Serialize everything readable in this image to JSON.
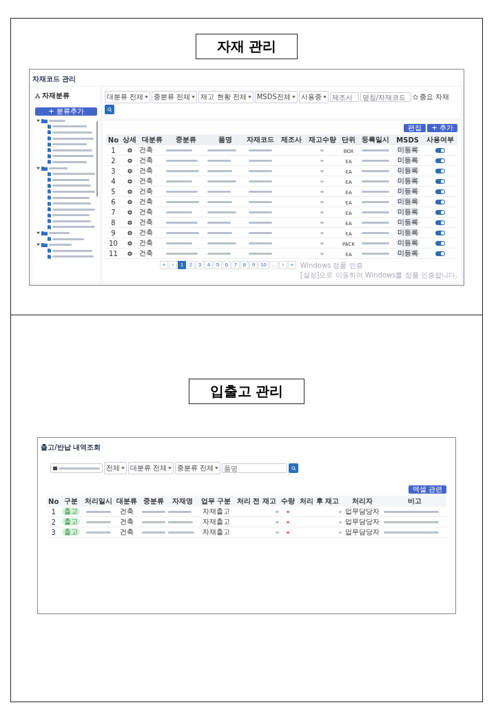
{
  "sections": [
    {
      "heading": "자재 관리",
      "screen": {
        "title": "자재코드 관리",
        "sidebar": {
          "title": "자재분류",
          "add_button": "+ 분류추가",
          "tree": [
            {
              "kind": "folder",
              "expanded": true,
              "children": [
                {
                  "kind": "file"
                },
                {
                  "kind": "file"
                },
                {
                  "kind": "file"
                },
                {
                  "kind": "file"
                },
                {
                  "kind": "file"
                },
                {
                  "kind": "file"
                },
                {
                  "kind": "file"
                }
              ]
            },
            {
              "kind": "folder",
              "expanded": true,
              "children": [
                {
                  "kind": "file"
                },
                {
                  "kind": "file"
                },
                {
                  "kind": "file"
                },
                {
                  "kind": "file"
                },
                {
                  "kind": "file"
                },
                {
                  "kind": "file"
                },
                {
                  "kind": "file"
                },
                {
                  "kind": "file"
                },
                {
                  "kind": "file"
                },
                {
                  "kind": "file"
                }
              ]
            },
            {
              "kind": "folder",
              "expanded": true,
              "children": [
                {
                  "kind": "file"
                }
              ]
            },
            {
              "kind": "folder",
              "expanded": true,
              "children": [
                {
                  "kind": "file"
                },
                {
                  "kind": "file"
                }
              ]
            }
          ]
        },
        "filters": [
          {
            "kind": "select",
            "value": "대분류 전체"
          },
          {
            "kind": "select",
            "value": "중분류 전체"
          },
          {
            "kind": "select",
            "value": "재고 현황 전체"
          },
          {
            "kind": "select",
            "value": "MSDS전체"
          },
          {
            "kind": "select",
            "value": "사용중"
          },
          {
            "kind": "input",
            "placeholder": "제조사"
          },
          {
            "kind": "input",
            "placeholder": "명칭/자재코드"
          },
          {
            "kind": "star",
            "label": "중요 자재"
          },
          {
            "kind": "search"
          }
        ],
        "buttons": [
          "편집",
          "+ 추가"
        ],
        "columns": [
          "No",
          "상세",
          "대분류",
          "중분류",
          "품명",
          "자재코드",
          "제조사",
          "재고수량",
          "단위",
          "등록일시",
          "MSDS",
          "사용여부"
        ],
        "rows": [
          {
            "no": "1",
            "category": "건축",
            "unit": "BOX",
            "msds": "미등록",
            "in_use": true
          },
          {
            "no": "2",
            "category": "건축",
            "unit": "EA",
            "msds": "미등록",
            "in_use": true
          },
          {
            "no": "3",
            "category": "건축",
            "unit": "EA",
            "msds": "미등록",
            "in_use": true
          },
          {
            "no": "4",
            "category": "건축",
            "unit": "EA",
            "msds": "미등록",
            "in_use": true
          },
          {
            "no": "5",
            "category": "건축",
            "unit": "EA",
            "msds": "미등록",
            "in_use": true
          },
          {
            "no": "6",
            "category": "건축",
            "unit": "EA",
            "msds": "미등록",
            "in_use": true
          },
          {
            "no": "7",
            "category": "건축",
            "unit": "EA",
            "msds": "미등록",
            "in_use": true
          },
          {
            "no": "8",
            "category": "건축",
            "unit": "EA",
            "msds": "미등록",
            "in_use": true
          },
          {
            "no": "9",
            "category": "건축",
            "unit": "EA",
            "msds": "미등록",
            "in_use": true
          },
          {
            "no": "10",
            "category": "건축",
            "unit": "PACK",
            "msds": "미등록",
            "in_use": true
          },
          {
            "no": "11",
            "category": "건축",
            "unit": "EA",
            "msds": "미등록",
            "in_use": true
          }
        ],
        "pagination": [
          {
            "label": "«",
            "selected": false
          },
          {
            "label": "‹",
            "selected": false
          },
          {
            "label": "1",
            "selected": true
          },
          {
            "label": "2",
            "selected": false
          },
          {
            "label": "3",
            "selected": false
          },
          {
            "label": "4",
            "selected": false
          },
          {
            "label": "5",
            "selected": false
          },
          {
            "label": "6",
            "selected": false
          },
          {
            "label": "7",
            "selected": false
          },
          {
            "label": "8",
            "selected": false
          },
          {
            "label": "9",
            "selected": false
          },
          {
            "label": "10",
            "selected": false
          },
          {
            "label": "...",
            "selected": false
          },
          {
            "label": "›",
            "selected": false
          },
          {
            "label": "»",
            "selected": false
          }
        ],
        "activation_notice": {
          "title": "Windows 정품 인증",
          "text": "[설정]으로 이동하여 Windows를 정품 인증합니다."
        }
      }
    },
    {
      "heading": "입출고 관리",
      "screen": {
        "title": "출고/반납 내역조회",
        "filters": [
          {
            "kind": "date"
          },
          {
            "kind": "select",
            "value": "전체"
          },
          {
            "kind": "select",
            "value": "대분류 전체"
          },
          {
            "kind": "select",
            "value": "중분류 전체"
          },
          {
            "kind": "input",
            "placeholder": "품명"
          },
          {
            "kind": "search"
          }
        ],
        "buttons": [
          "엑셀 관련"
        ],
        "columns": [
          "No",
          "구분",
          "처리일시",
          "대분류",
          "중분류",
          "자재명",
          "업무 구분",
          "처리 전 재고",
          "수량",
          "처리 후 재고",
          "처리자",
          "비고"
        ],
        "rows": [
          {
            "no": "1",
            "type": "출고",
            "category": "건축",
            "work": "자재출고",
            "handler": "업무담당자"
          },
          {
            "no": "2",
            "type": "출고",
            "category": "건축",
            "work": "자재출고",
            "handler": "업무담당자"
          },
          {
            "no": "3",
            "type": "출고",
            "category": "건축",
            "work": "자재출고",
            "handler": "업무담당자"
          }
        ]
      }
    }
  ]
}
